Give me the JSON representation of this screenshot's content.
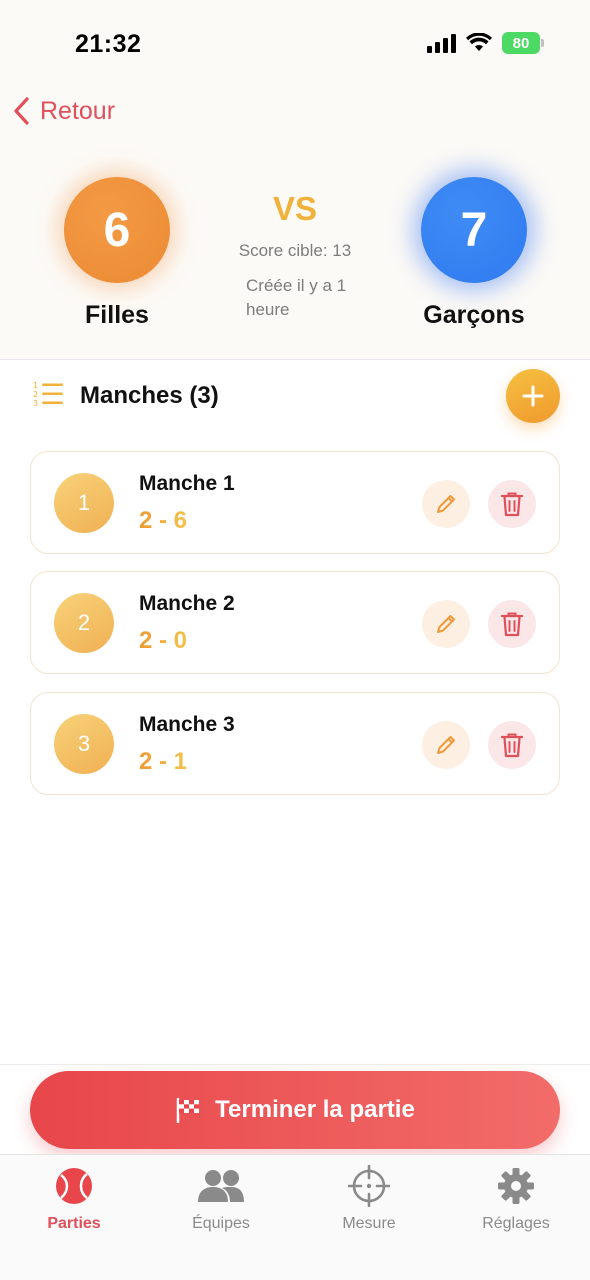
{
  "status_bar": {
    "time": "21:32",
    "battery": "80"
  },
  "nav": {
    "back_label": "Retour"
  },
  "match": {
    "team_left": {
      "name": "Filles",
      "score": "6"
    },
    "team_right": {
      "name": "Garçons",
      "score": "7"
    },
    "vs_label": "VS",
    "target_label": "Score cible: 13",
    "created_label": "Créée il y a 1 heure"
  },
  "rounds": {
    "title": "Manches (3)",
    "items": [
      {
        "number": "1",
        "name": "Manche 1",
        "score": "2 - 6"
      },
      {
        "number": "2",
        "name": "Manche 2",
        "score": "2 - 0"
      },
      {
        "number": "3",
        "name": "Manche 3",
        "score": "2 - 1"
      }
    ]
  },
  "actions": {
    "finish_label": "Terminer la partie"
  },
  "tabbar": {
    "tabs": [
      {
        "label": "Parties",
        "icon": "tennis-ball-icon",
        "active": true
      },
      {
        "label": "Équipes",
        "icon": "people-icon",
        "active": false
      },
      {
        "label": "Mesure",
        "icon": "crosshair-icon",
        "active": false
      },
      {
        "label": "Réglages",
        "icon": "gear-icon",
        "active": false
      }
    ]
  },
  "colors": {
    "accent_red": "#e0505a",
    "orange": "#ec8a33",
    "blue": "#2f7af0",
    "gold": "#f0b23a"
  }
}
